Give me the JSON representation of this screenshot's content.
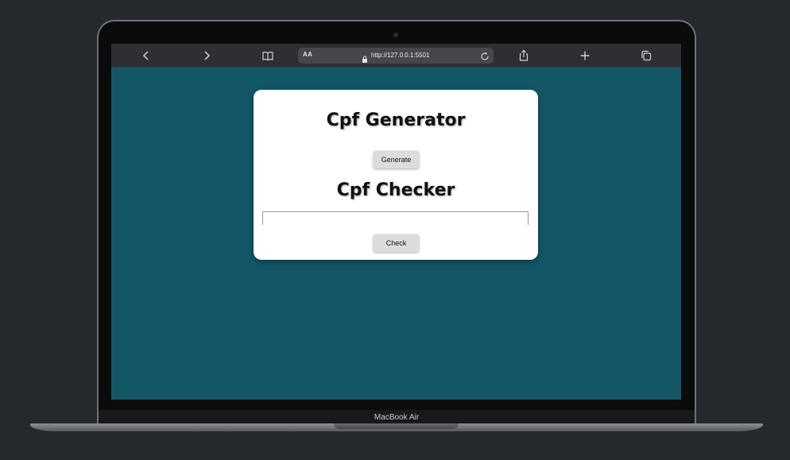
{
  "browser": {
    "aa_label": "AA",
    "url": "http://127.0.0.1:5501",
    "icons": [
      "back-icon",
      "forward-icon",
      "bookmarks-icon",
      "lock-icon",
      "reload-icon",
      "share-icon",
      "new-tab-icon",
      "tabs-icon"
    ]
  },
  "page": {
    "background_color": "#135767",
    "generator_title": "Cpf Generator",
    "generate_button": "Generate",
    "checker_title": "Cpf Checker",
    "cpf_input_value": "",
    "check_button": "Check"
  },
  "device": {
    "model_label": "MacBook Air"
  }
}
